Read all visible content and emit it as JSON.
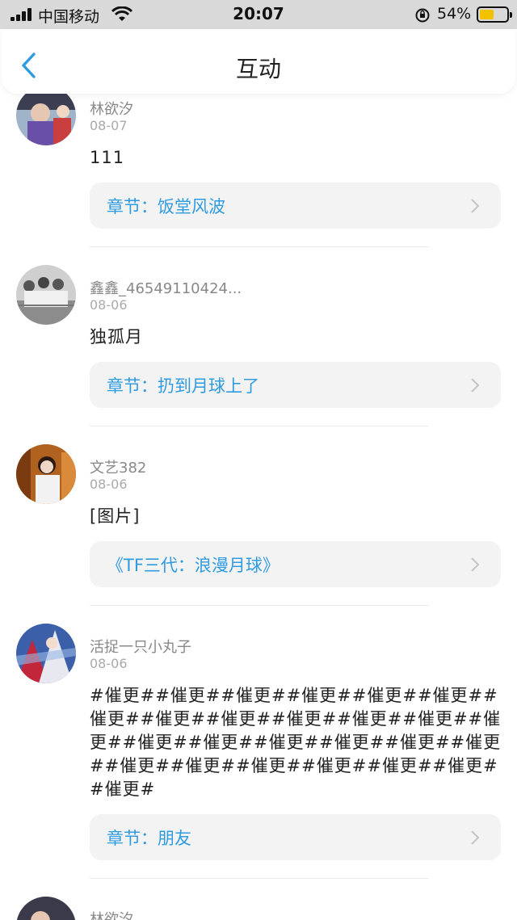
{
  "status_bar": {
    "carrier": "中国移动",
    "time": "20:07",
    "battery_percent": "54%",
    "battery_level": 0.54,
    "battery_color": "#f2c200"
  },
  "header": {
    "back_icon": "chevron-left-icon",
    "title": "互动"
  },
  "accent_color": "#2f9be0",
  "feed": [
    {
      "username": "林欲汐",
      "date": "08-07",
      "content": "111",
      "reference": "章节：饭堂风波"
    },
    {
      "username": "鑫鑫_46549110424...",
      "date": "08-06",
      "content": "独孤月",
      "reference": "章节：扔到月球上了"
    },
    {
      "username": "文艺382",
      "date": "08-06",
      "content": "[图片]",
      "reference": "《TF三代：浪漫月球》"
    },
    {
      "username": "活捉一只小丸子",
      "date": "08-06",
      "content": "#催更##催更##催更##催更##催更##催更##催更##催更##催更##催更##催更##催更##催更##催更##催更##催更##催更##催更##催更##催更##催更##催更##催更##催更##催更##催更#",
      "reference": "章节：朋友"
    },
    {
      "username": "林欲汐",
      "date": "",
      "content": "",
      "reference": ""
    }
  ]
}
